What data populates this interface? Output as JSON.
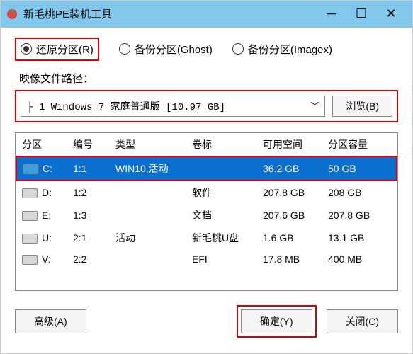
{
  "titlebar": {
    "title": "新毛桃PE装机工具"
  },
  "radios": {
    "restore": "还原分区(R)",
    "backup_ghost": "备份分区(Ghost)",
    "backup_imagex": "备份分区(Imagex)"
  },
  "image_path": {
    "label": "映像文件路径：",
    "selected": "├ 1 Windows 7 家庭普通版 [10.97 GB]",
    "browse": "浏览(B)"
  },
  "table": {
    "headers": {
      "drive": "分区",
      "number": "编号",
      "type": "类型",
      "label": "卷标",
      "free": "可用空间",
      "capacity": "分区容量"
    },
    "rows": [
      {
        "drive": "C:",
        "number": "1:1",
        "type": "WIN10,活动",
        "label": "",
        "free": "36.2 GB",
        "capacity": "50 GB",
        "selected": true,
        "icon": "blue"
      },
      {
        "drive": "D:",
        "number": "1:2",
        "type": "",
        "label": "软件",
        "free": "207.8 GB",
        "capacity": "208 GB",
        "selected": false,
        "icon": "gray"
      },
      {
        "drive": "E:",
        "number": "1:3",
        "type": "",
        "label": "文档",
        "free": "207.6 GB",
        "capacity": "207.8 GB",
        "selected": false,
        "icon": "gray"
      },
      {
        "drive": "U:",
        "number": "2:1",
        "type": "活动",
        "label": "新毛桃U盘",
        "free": "1.6 GB",
        "capacity": "13.1 GB",
        "selected": false,
        "icon": "gray"
      },
      {
        "drive": "V:",
        "number": "2:2",
        "type": "",
        "label": "EFI",
        "free": "17.8 MB",
        "capacity": "400 MB",
        "selected": false,
        "icon": "gray"
      }
    ]
  },
  "footer": {
    "advanced": "高级(A)",
    "ok": "确定(Y)",
    "close": "关闭(C)"
  },
  "colors": {
    "titlebar": "#82c7ec",
    "selection": "#0a6fcf",
    "highlight": "#d00"
  }
}
